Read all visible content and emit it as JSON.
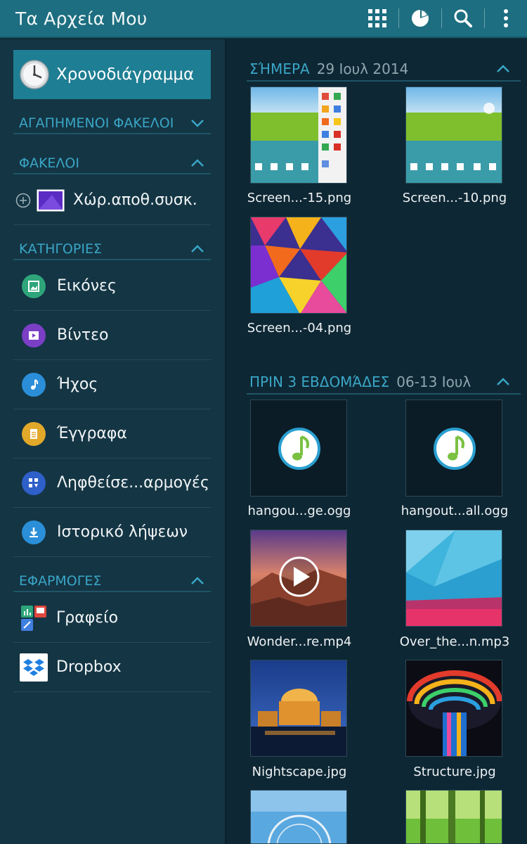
{
  "app": {
    "title": "Τα Αρχεία Μου"
  },
  "toolbar": {
    "icons": [
      "grid-icon",
      "storage-pie-icon",
      "search-icon",
      "overflow-menu-icon"
    ]
  },
  "sidebar": {
    "timeline_label": "Χρονοδιάγραμμα",
    "favorites_header": "ΑΓΑΠΗΜΕΝΟΙ ΦΑΚΕΛΟΙ",
    "folders_header": "ΦΑΚΕΛΟΙ",
    "device_storage_label": "Χώρ.αποθ.συσκ.",
    "categories_header": "ΚΑΤΗΓΟΡΙΕΣ",
    "categories": [
      {
        "label": "Εικόνες",
        "icon": "image-icon",
        "color": "#2ea57a"
      },
      {
        "label": "Βίντεο",
        "icon": "video-icon",
        "color": "#7b3fc6"
      },
      {
        "label": "Ήχος",
        "icon": "music-note-icon",
        "color": "#2a8fd8"
      },
      {
        "label": "Έγγραφα",
        "icon": "document-icon",
        "color": "#e1a82a"
      },
      {
        "label": "Ληφθείσε...αρμογές",
        "icon": "downloaded-apps-icon",
        "color": "#2f5fc9"
      },
      {
        "label": "Ιστορικό λήψεων",
        "icon": "download-icon",
        "color": "#2a8fd8"
      }
    ],
    "apps_header": "ΕΦΑΡΜΟΓΕΣ",
    "apps": [
      {
        "label": "Γραφείο",
        "icon": "office-icon"
      },
      {
        "label": "Dropbox",
        "icon": "dropbox-icon"
      }
    ]
  },
  "content": {
    "today": {
      "title": "ΣΉΜΕΡΑ",
      "date": "29 Ιουλ 2014",
      "files": [
        "Screen...-15.png",
        "Screen...-10.png",
        "Screen...-04.png"
      ]
    },
    "weeks_ago": {
      "title": "ΠΡΙΝ 3 ΕΒΔΟΜΆΔΕΣ",
      "date": "06-13 Ιουλ",
      "files": [
        "hangou...ge.ogg",
        "hangout...all.ogg",
        "Wonder...re.mp4",
        "Over_the...n.mp3",
        "Nightscape.jpg",
        "Structure.jpg"
      ]
    }
  },
  "colors": {
    "topbar": "#1c6e80",
    "accent": "#3aa6c6",
    "selected": "#1e7e93"
  }
}
